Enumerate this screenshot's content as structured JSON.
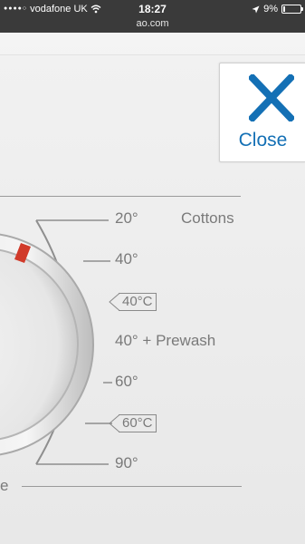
{
  "status_bar": {
    "carrier": "vodafone UK",
    "time": "18:27",
    "battery_percent": "9%",
    "battery_level": 0.09,
    "icons": [
      "signal-dots-icon",
      "wifi-icon",
      "location-arrow-icon",
      "battery-icon"
    ]
  },
  "url_bar": {
    "url": "ao.com"
  },
  "close_button": {
    "label": "Close",
    "icon": "close-x-icon",
    "color": "#1470b5"
  },
  "dial": {
    "indicator_color": "#d13a2a",
    "programs": [
      {
        "label": "20°",
        "secondary": "Cottons"
      },
      {
        "label": "40°"
      },
      {
        "label": "40°C",
        "boxed": true
      },
      {
        "label": "40° + Prewash"
      },
      {
        "label": "60°"
      },
      {
        "label": "60°C",
        "boxed": true
      },
      {
        "label": "90°"
      }
    ],
    "bottom_fragment": "e"
  }
}
